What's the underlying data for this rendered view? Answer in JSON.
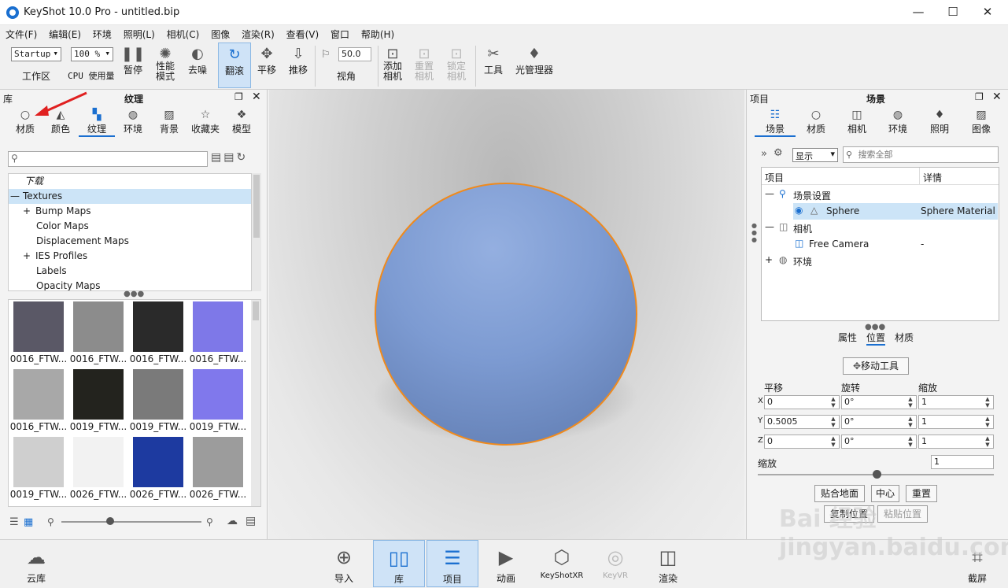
{
  "window": {
    "title": "KeyShot 10.0 Pro  - untitled.bip",
    "minimize": "—",
    "maximize": "☐",
    "close": "✕"
  },
  "menu": [
    "文件(F)",
    "编辑(E)",
    "环境",
    "照明(L)",
    "相机(C)",
    "图像",
    "渲染(R)",
    "查看(V)",
    "窗口",
    "帮助(H)"
  ],
  "toolbar": {
    "workspace_value": "Startup",
    "workspace_label": "工作区",
    "cpu_value": "100 %",
    "cpu_label": "CPU 使用量",
    "pause": "暂停",
    "perf_mode": "性能\n模式",
    "denoise": "去噪",
    "tumble": "翻滚",
    "pan": "平移",
    "dolly": "推移",
    "fov_value": "50.0",
    "fov_label": "视角",
    "add_camera": "添加\n相机",
    "reset_camera": "重置\n相机",
    "lock_camera": "锁定\n相机",
    "tools": "工具",
    "light_manager": "光管理器"
  },
  "library": {
    "header_left": "库",
    "header_title": "纹理",
    "tabs": [
      {
        "label": "材质",
        "icon": "material-ball-icon"
      },
      {
        "label": "颜色",
        "icon": "paint-bucket-icon"
      },
      {
        "label": "纹理",
        "icon": "texture-icon"
      },
      {
        "label": "环境",
        "icon": "globe-icon"
      },
      {
        "label": "背景",
        "icon": "image-icon"
      },
      {
        "label": "收藏夹",
        "icon": "star-icon"
      },
      {
        "label": "模型",
        "icon": "models-icon"
      }
    ],
    "tree": [
      {
        "label": "下载",
        "expander": ""
      },
      {
        "label": "Textures",
        "expander": "—"
      },
      {
        "label": "Bump Maps",
        "expander": "+"
      },
      {
        "label": "Color Maps",
        "expander": ""
      },
      {
        "label": "Displacement Maps",
        "expander": ""
      },
      {
        "label": "IES Profiles",
        "expander": "+"
      },
      {
        "label": "Labels",
        "expander": ""
      },
      {
        "label": "Opacity Maps",
        "expander": ""
      }
    ],
    "thumbnails": [
      {
        "label": "0016_FTW...",
        "color": "#5a5866"
      },
      {
        "label": "0016_FTW...",
        "color": "#8c8c8c"
      },
      {
        "label": "0016_FTW...",
        "color": "#2a2a2a"
      },
      {
        "label": "0016_FTW...",
        "color": "#7e78e8"
      },
      {
        "label": "0016_FTW...",
        "color": "#a8a8a8"
      },
      {
        "label": "0019_FTW...",
        "color": "#23231e"
      },
      {
        "label": "0019_FTW...",
        "color": "#7a7a7a"
      },
      {
        "label": "0019_FTW...",
        "color": "#8078ec"
      },
      {
        "label": "0019_FTW...",
        "color": "#cfcfcf"
      },
      {
        "label": "0026_FTW...",
        "color": "#f2f2f2"
      },
      {
        "label": "0026_FTW...",
        "color": "#1d3aa0"
      },
      {
        "label": "0026_FTW...",
        "color": "#9c9c9c"
      }
    ]
  },
  "project": {
    "header_left": "项目",
    "header_title": "场景",
    "tabs": [
      {
        "label": "场景",
        "icon": "scene-list-icon"
      },
      {
        "label": "材质",
        "icon": "material-ball-icon"
      },
      {
        "label": "相机",
        "icon": "camera-icon"
      },
      {
        "label": "环境",
        "icon": "globe-icon"
      },
      {
        "label": "照明",
        "icon": "bulb-icon"
      },
      {
        "label": "图像",
        "icon": "image-icon"
      }
    ],
    "display_label": "显示",
    "search_placeholder": "搜索全部",
    "tree_cols": [
      "项目",
      "详情"
    ],
    "tree_rows": [
      {
        "label": "场景设置",
        "detail": "",
        "expander": "—"
      },
      {
        "label": "Sphere",
        "detail": "Sphere Material",
        "expander": ""
      },
      {
        "label": "相机",
        "detail": "",
        "expander": "—"
      },
      {
        "label": "Free Camera",
        "detail": "-",
        "expander": ""
      },
      {
        "label": "环境",
        "detail": "",
        "expander": "+"
      }
    ],
    "subtabs": [
      "属性",
      "位置",
      "材质"
    ],
    "move_tool": "移动工具",
    "col_translate": "平移",
    "col_rotate": "旋转",
    "col_scale": "缩放",
    "axes": [
      {
        "axis": "X",
        "t": "0",
        "r": "0°",
        "s": "1"
      },
      {
        "axis": "Y",
        "t": "0.5005",
        "r": "0°",
        "s": "1"
      },
      {
        "axis": "Z",
        "t": "0",
        "r": "0°",
        "s": "1"
      }
    ],
    "uniform_scale_label": "缩放",
    "uniform_scale_value": "1",
    "snap_ground": "贴合地面",
    "center": "中心",
    "reset": "重置",
    "copy_position": "复制位置",
    "paste_position": "粘贴位置"
  },
  "bottom": {
    "cloud": "云库",
    "import": "导入",
    "library": "库",
    "project": "项目",
    "animation": "动画",
    "keyshotxr": "KeyShotXR",
    "keyvr": "KeyVR",
    "render": "渲染",
    "screenshot": "截屏"
  },
  "colors": {
    "accent": "#1a6fd0",
    "selection": "#cce4f7",
    "sphere": "#7d9bd2",
    "outline": "#f08a1c"
  },
  "watermark": "Bai 经验 jingyan.baidu.com"
}
